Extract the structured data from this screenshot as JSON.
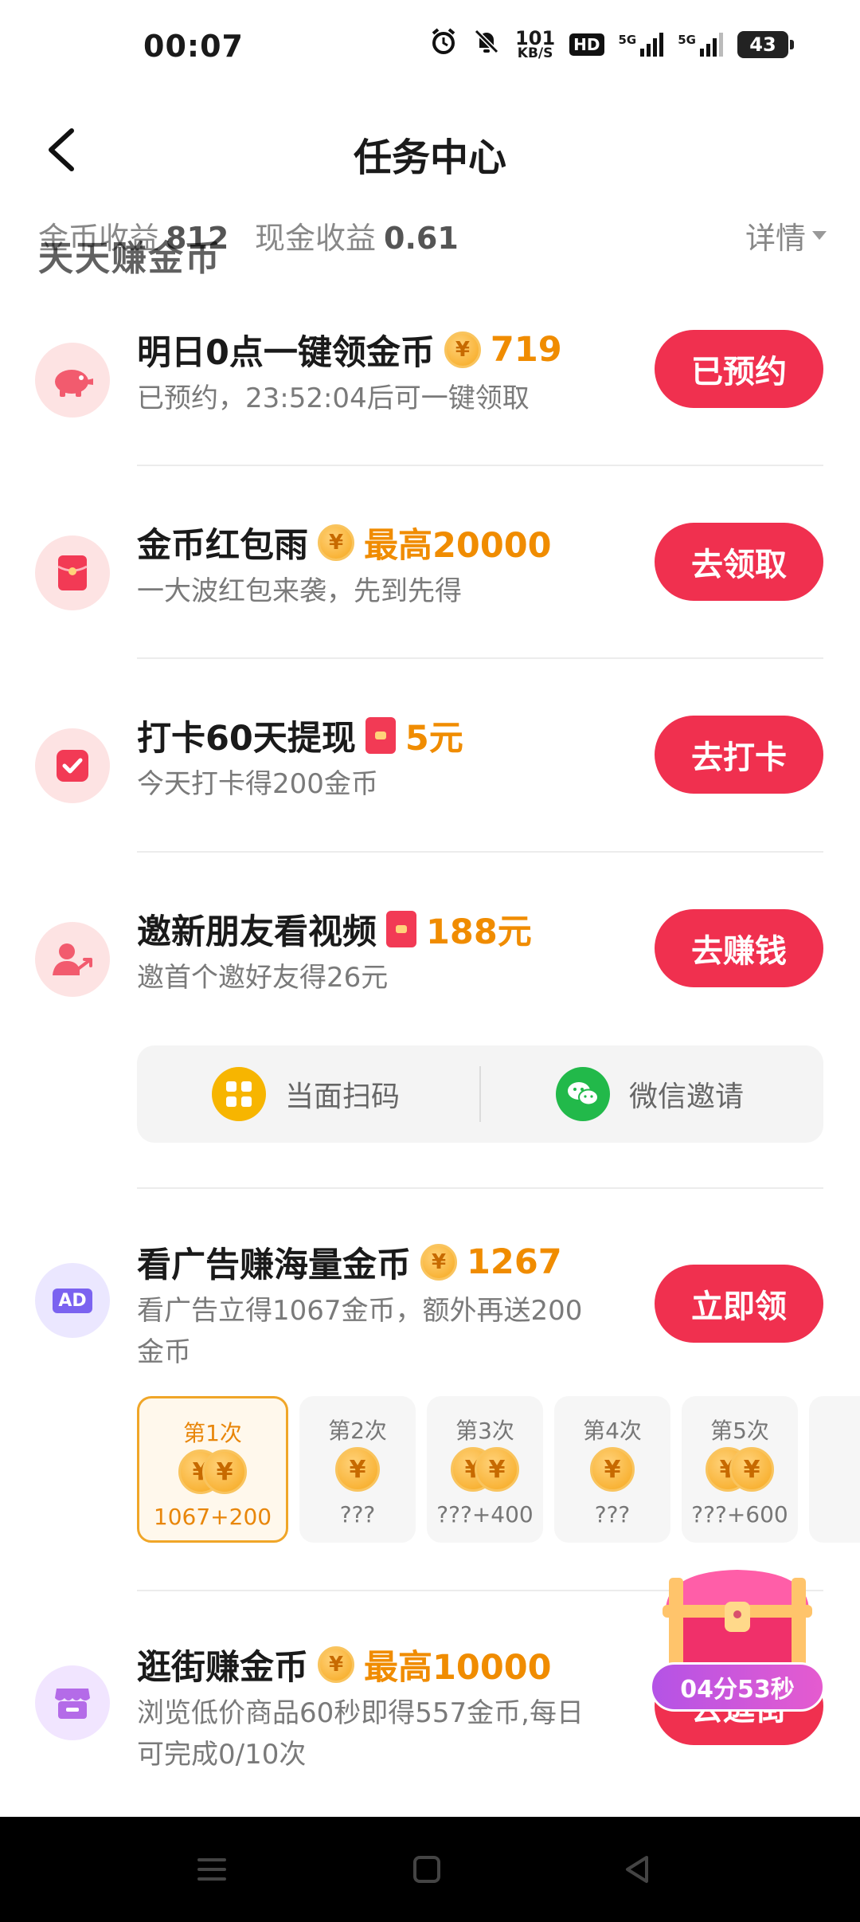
{
  "status_bar": {
    "time": "00:07",
    "net_speed_top": "101",
    "net_speed_bottom": "KB/S",
    "hd": "HD",
    "sig1_label": "5G",
    "sig2_label": "5G",
    "battery": "43"
  },
  "header": {
    "title": "任务中心"
  },
  "earnings": {
    "overlay_text": "天天赚金币",
    "coin_label": "金币收益",
    "coin_value": "812",
    "cash_label": "现金收益",
    "cash_value": "0.61",
    "detail_label": "详情"
  },
  "tasks": [
    {
      "title": "明日0点一键领金币",
      "reward": "719",
      "reward_icon": "coin-icon",
      "subtitle": "已预约，23:52:04后可一键领取",
      "button": "已预约",
      "icon": "piggy-bank-icon"
    },
    {
      "title": "金币红包雨",
      "reward": "最高20000",
      "reward_icon": "coin-icon",
      "subtitle": "一大波红包来袭，先到先得",
      "button": "去领取",
      "icon": "red-envelope-icon"
    },
    {
      "title": "打卡60天提现",
      "reward": "5元",
      "reward_icon": "red-envelope-icon",
      "subtitle": "今天打卡得200金币",
      "button": "去打卡",
      "icon": "checkbox-icon"
    },
    {
      "title": "邀新朋友看视频",
      "reward": "188元",
      "reward_icon": "red-envelope-icon",
      "subtitle": "邀首个邀好友得26元",
      "button": "去赚钱",
      "icon": "invite-friends-icon"
    },
    {
      "title": "看广告赚海量金币",
      "reward": "1267",
      "reward_icon": "coin-icon",
      "subtitle_line1": "看广告立得1067金币，额外再送200",
      "subtitle_line2": "金币",
      "button": "立即领",
      "icon": "ad-icon",
      "icon_text": "AD"
    },
    {
      "title": "逛街赚金币",
      "reward": "最高10000",
      "reward_icon": "coin-icon",
      "subtitle_line1": "浏览低价商品60秒即得557金币,每日",
      "subtitle_line2": "可完成0/10次",
      "button": "去逛街",
      "icon": "shop-icon"
    }
  ],
  "invite": {
    "scan_label": "当面扫码",
    "wechat_label": "微信邀请"
  },
  "ad_rounds": [
    {
      "label": "第1次",
      "value": "1067+200",
      "coins": 2,
      "active": true
    },
    {
      "label": "第2次",
      "value": "???",
      "coins": 1,
      "active": false
    },
    {
      "label": "第3次",
      "value": "???+400",
      "coins": 2,
      "active": false
    },
    {
      "label": "第4次",
      "value": "???",
      "coins": 1,
      "active": false
    },
    {
      "label": "第5次",
      "value": "???+600",
      "coins": 2,
      "active": false
    }
  ],
  "treasure": {
    "timer": "04分53秒"
  },
  "colors": {
    "accent_red": "#f0304f",
    "reward_orange": "#f08c00",
    "icon_bg": "#fde3e3"
  }
}
